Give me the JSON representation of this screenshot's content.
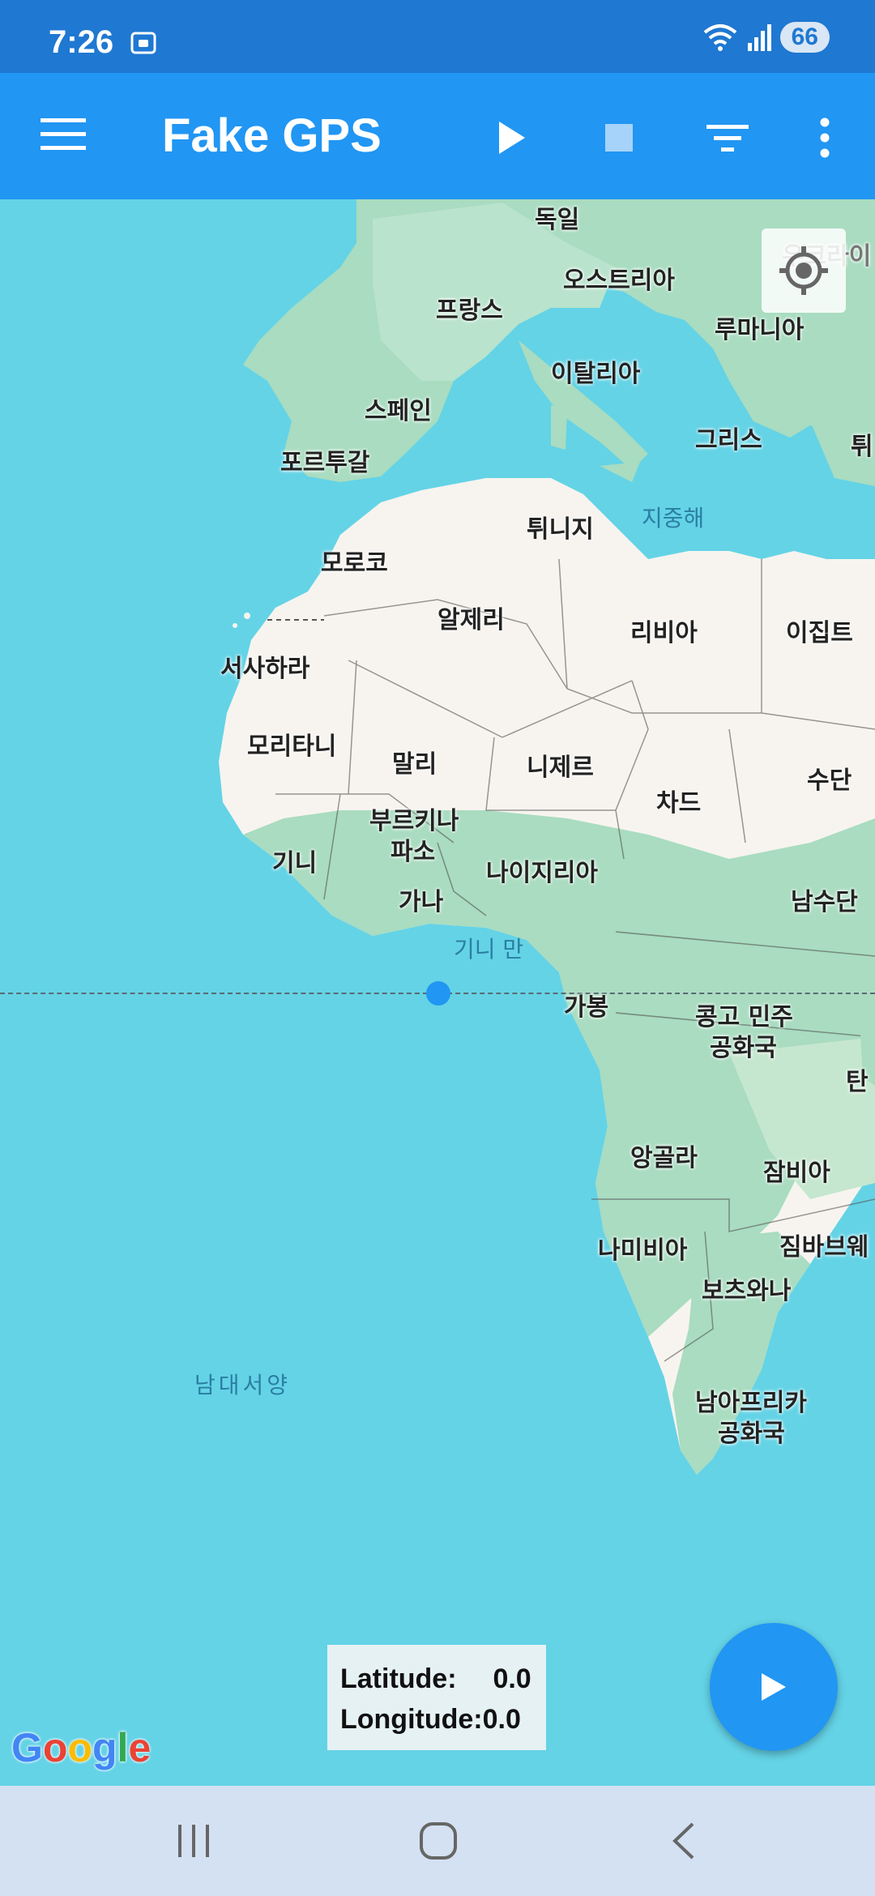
{
  "status_bar": {
    "time": "7:26",
    "battery": "66",
    "icons": [
      "screen-record-icon",
      "wifi-icon",
      "signal-icon"
    ]
  },
  "app_bar": {
    "title": "Fake GPS",
    "actions": [
      "menu-icon",
      "play-icon",
      "stop-icon",
      "filter-icon",
      "more-vert-icon"
    ]
  },
  "map": {
    "country_labels": [
      "독일",
      "오스트리아",
      "우크라이",
      "프랑스",
      "루마니아",
      "이탈리아",
      "스페인",
      "그리스",
      "튀",
      "포르투갈",
      "튀니지",
      "모로코",
      "알제리",
      "리비아",
      "이집트",
      "서사하라",
      "모리타니",
      "말리",
      "니제르",
      "차드",
      "수단",
      "부르키나",
      "파소",
      "기니",
      "나이지리아",
      "가나",
      "남수단",
      "가봉",
      "콩고 민주",
      "공화국",
      "탄",
      "앙골라",
      "잠비아",
      "나미비아",
      "짐바브웨",
      "보츠와나",
      "남아프리카",
      "공화국"
    ],
    "sea_labels": [
      "지중해",
      "기니 만",
      "남대서양"
    ],
    "attribution": "Google",
    "colors": {
      "water": "#64d3e6",
      "land": "#f7f4ef",
      "vegetation": "#a9dcc0",
      "marker": "#2196f3"
    }
  },
  "coordinates": {
    "latitude_label": "Latitude:",
    "latitude_value": "0.0",
    "longitude_label": "Longitude:",
    "longitude_value": "0.0"
  },
  "fab": {
    "icon": "play-icon"
  },
  "nav_bar": {
    "buttons": [
      "recents-icon",
      "home-icon",
      "back-icon"
    ]
  }
}
